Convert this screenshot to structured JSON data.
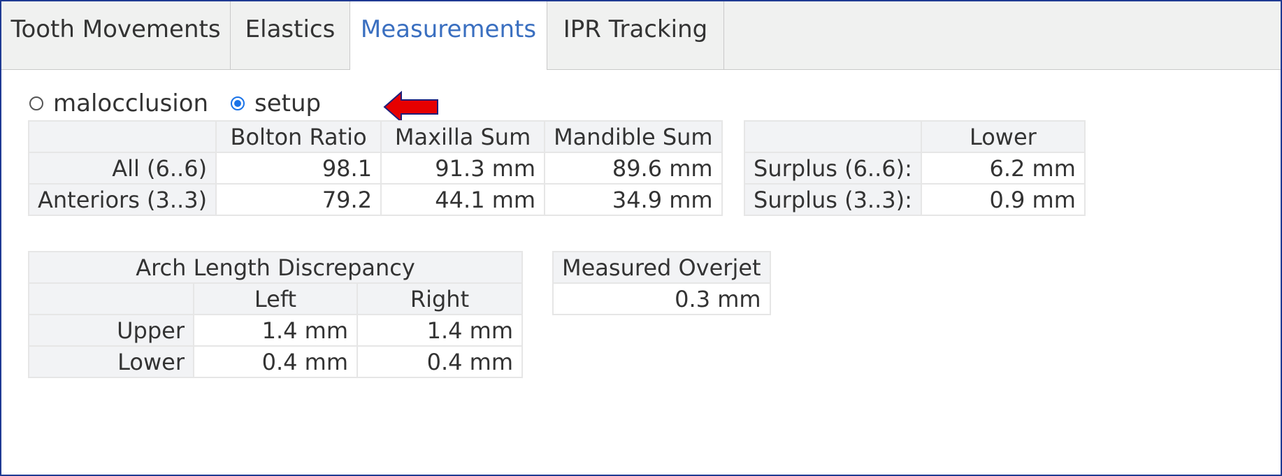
{
  "tabs": [
    {
      "label": "Tooth Movements",
      "active": false
    },
    {
      "label": "Elastics",
      "active": false
    },
    {
      "label": "Measurements",
      "active": true
    },
    {
      "label": "IPR Tracking",
      "active": false
    }
  ],
  "view_mode": {
    "options": [
      "malocclusion",
      "setup"
    ],
    "selected": "setup"
  },
  "annotation": {
    "arrow_color": "#e60000"
  },
  "bolton_table": {
    "headers": [
      "",
      "Bolton Ratio",
      "Maxilla Sum",
      "Mandible Sum"
    ],
    "rows": [
      {
        "label": "All (6..6)",
        "bolton": "98.1",
        "maxilla": "91.3 mm",
        "mandible": "89.6 mm"
      },
      {
        "label": "Anteriors (3..3)",
        "bolton": "79.2",
        "maxilla": "44.1 mm",
        "mandible": "34.9 mm"
      }
    ]
  },
  "surplus_table": {
    "headers": [
      "",
      "Lower"
    ],
    "rows": [
      {
        "label": "Surplus (6..6):",
        "value": "6.2 mm"
      },
      {
        "label": "Surplus (3..3):",
        "value": "0.9 mm"
      }
    ]
  },
  "arch_table": {
    "title": "Arch Length Discrepancy",
    "headers": [
      "",
      "Left",
      "Right"
    ],
    "rows": [
      {
        "label": "Upper",
        "left": "1.4 mm",
        "right": "1.4 mm"
      },
      {
        "label": "Lower",
        "left": "0.4 mm",
        "right": "0.4 mm"
      }
    ]
  },
  "overjet_table": {
    "title": "Measured Overjet",
    "value": "0.3 mm"
  },
  "colors": {
    "accent": "#3a6fc0",
    "frame": "#1f3a93",
    "radio": "#1a73e8"
  }
}
